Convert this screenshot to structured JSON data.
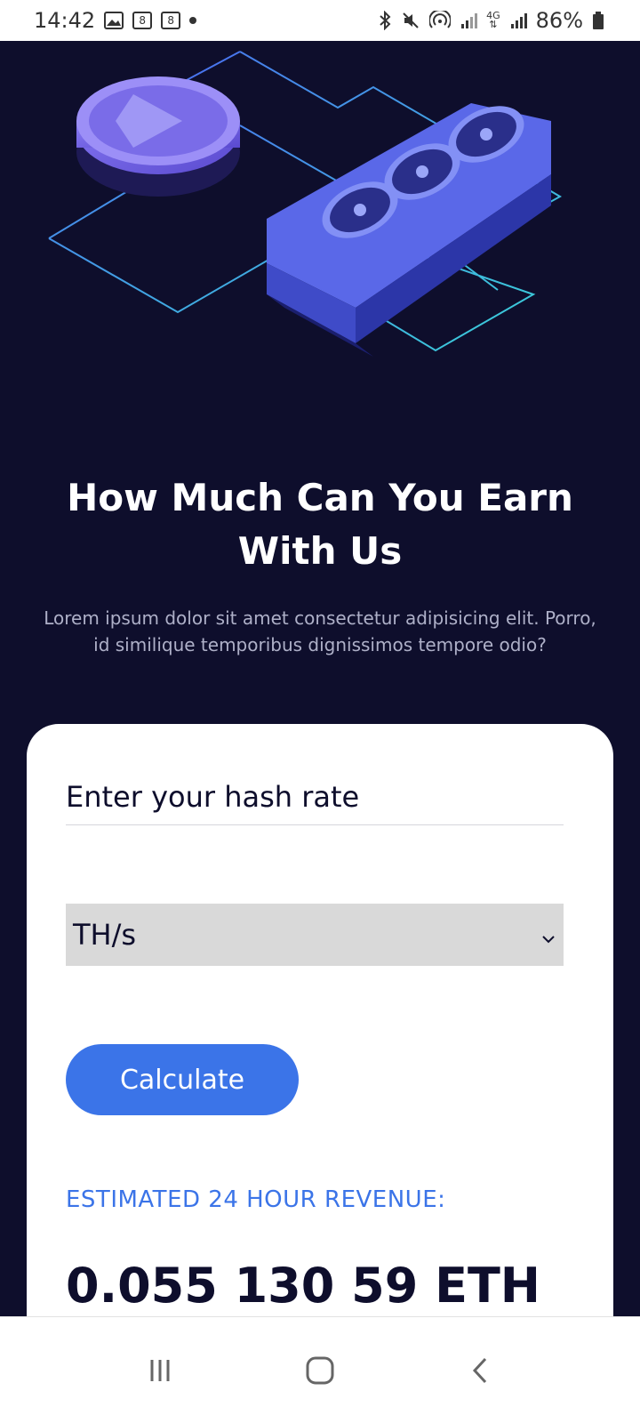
{
  "status_bar": {
    "time": "14:42",
    "battery": "86%",
    "icons": [
      "image-icon",
      "notification-icon",
      "notification-icon",
      "dot-icon",
      "bluetooth-icon",
      "mute-icon",
      "hotspot-icon",
      "signal-icon",
      "4g-icon",
      "signal-icon",
      "battery-icon"
    ]
  },
  "hero": {
    "illustration": "gpu-mining-rig-with-ethereum-coin"
  },
  "headline": "How Much Can You Earn With Us",
  "subtext": "Lorem ipsum dolor sit amet consectetur adipisicing elit. Porro, id similique temporibus dignissimos tempore odio?",
  "calculator": {
    "hash_input_placeholder": "Enter your hash rate",
    "hash_input_value": "",
    "unit_selected": "TH/s",
    "calculate_label": "Calculate",
    "revenue_label": "ESTIMATED 24 HOUR REVENUE:",
    "revenue_value": "0.055 130 59 ETH"
  },
  "nav_bar": {
    "buttons": [
      "recent-apps",
      "home",
      "back"
    ]
  },
  "colors": {
    "background": "#0e0e2c",
    "accent": "#3b74e8",
    "card": "#ffffff"
  }
}
